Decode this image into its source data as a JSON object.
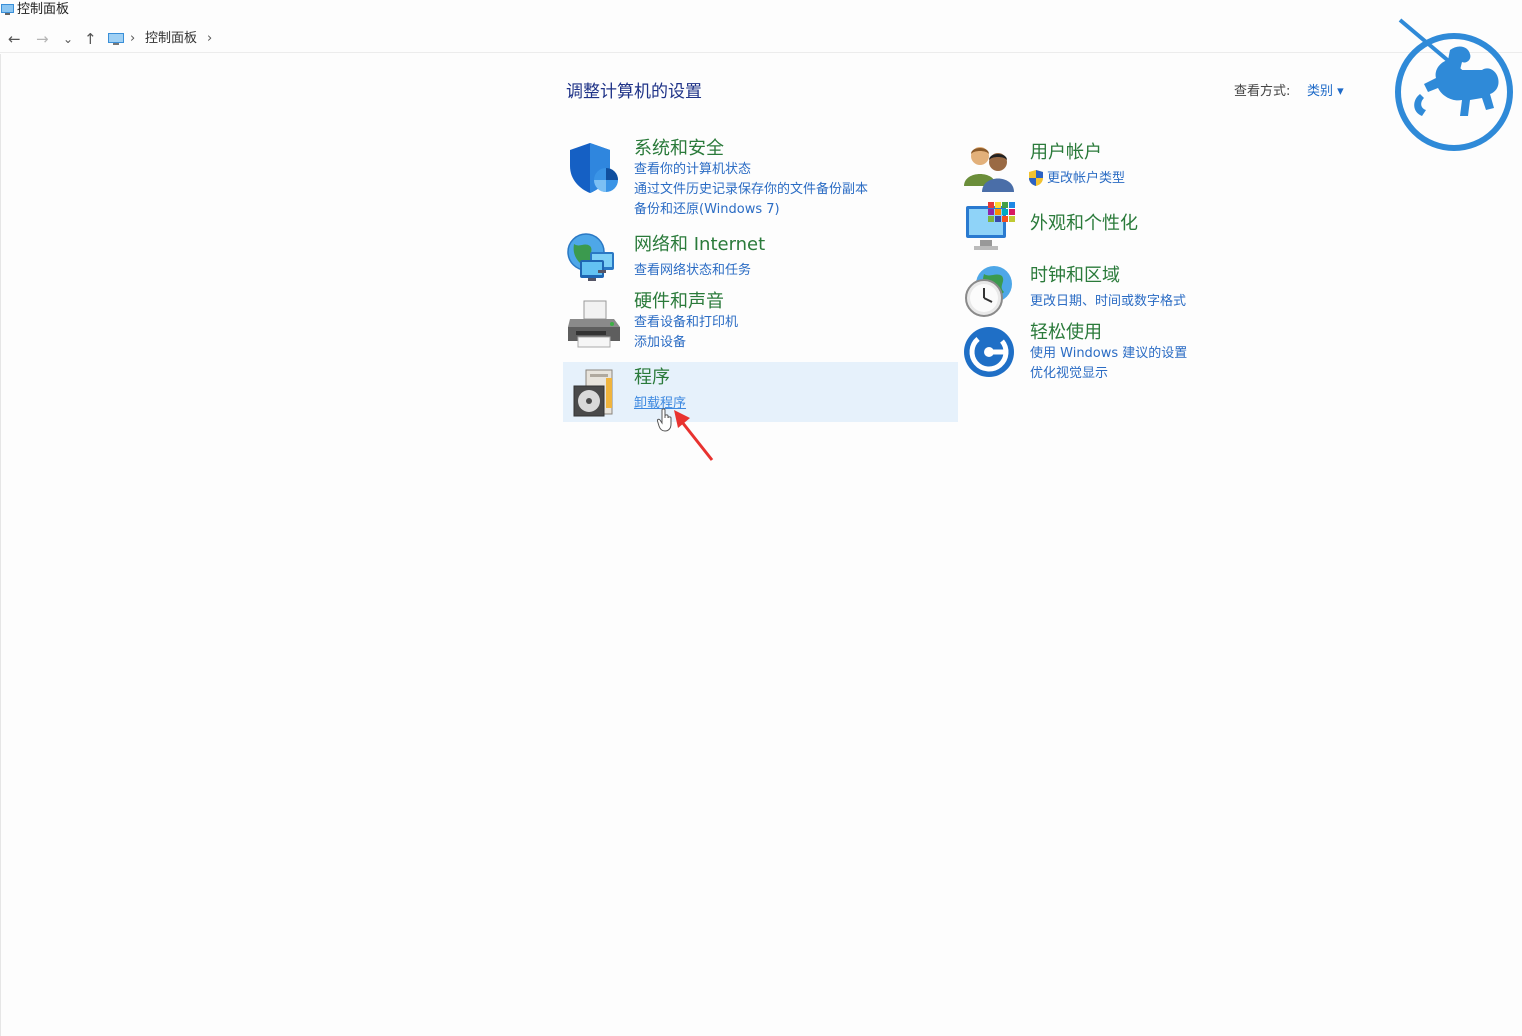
{
  "window": {
    "title": "控制面板"
  },
  "address": {
    "breadcrumb": "控制面板"
  },
  "nav": {
    "back": "←",
    "forward": "→",
    "recent": "⌄",
    "up": "↑",
    "sep": "›"
  },
  "page": {
    "title": "调整计算机的设置"
  },
  "view_by": {
    "label": "查看方式:",
    "value": "类别 ▾"
  },
  "categories_left": [
    {
      "title": "系统和安全",
      "links": [
        "查看你的计算机状态",
        "通过文件历史记录保存你的文件备份副本",
        "备份和还原(Windows 7)"
      ]
    },
    {
      "title": "网络和 Internet",
      "links": [
        "查看网络状态和任务"
      ]
    },
    {
      "title": "硬件和声音",
      "links": [
        "查看设备和打印机",
        "添加设备"
      ]
    },
    {
      "title": "程序",
      "links": [
        "卸载程序"
      ]
    }
  ],
  "categories_right": [
    {
      "title": "用户帐户",
      "links": [
        "更改帐户类型"
      ]
    },
    {
      "title": "外观和个性化",
      "links": []
    },
    {
      "title": "时钟和区域",
      "links": [
        "更改日期、时间或数字格式"
      ]
    },
    {
      "title": "轻松使用",
      "links": [
        "使用 Windows 建议的设置",
        "优化视觉显示"
      ]
    }
  ],
  "colors": {
    "category_title": "#2a7a3a",
    "link": "#2b6cc4",
    "page_title": "#1e3287",
    "highlight": "#e6f1fb",
    "annotation_arrow": "#e8322f",
    "logo": "#2f8ad8"
  }
}
